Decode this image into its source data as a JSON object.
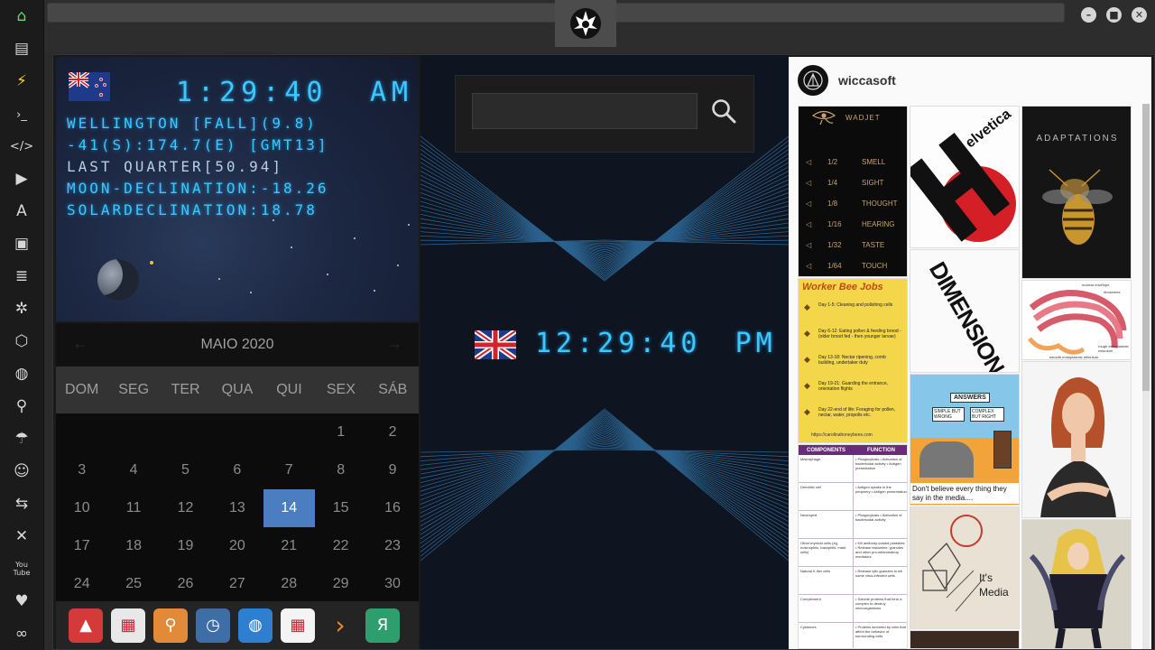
{
  "dock": {
    "items": [
      {
        "name": "home-icon",
        "glyph": "⌂",
        "color": "#6fd46f"
      },
      {
        "name": "document-icon",
        "glyph": "▤"
      },
      {
        "name": "lightning-icon",
        "glyph": "⚡",
        "color": "#f2c94c"
      },
      {
        "name": "terminal-icon",
        "glyph": "›_"
      },
      {
        "name": "code-icon",
        "glyph": "</>"
      },
      {
        "name": "play-icon",
        "glyph": "▶"
      },
      {
        "name": "translate-icon",
        "glyph": "A"
      },
      {
        "name": "image-icon",
        "glyph": "▣"
      },
      {
        "name": "news-icon",
        "glyph": "≣"
      },
      {
        "name": "aperture-icon",
        "glyph": "✲"
      },
      {
        "name": "hexagon-icon",
        "glyph": "⬡"
      },
      {
        "name": "globe-icon",
        "glyph": "◍"
      },
      {
        "name": "search-icon",
        "glyph": "⚲"
      },
      {
        "name": "umbrella-icon",
        "glyph": "☂"
      },
      {
        "name": "contacts-icon",
        "glyph": "☺"
      },
      {
        "name": "link-icon",
        "glyph": "⇆"
      },
      {
        "name": "fullscreen-icon",
        "glyph": "✕"
      },
      {
        "name": "youtube-icon",
        "glyph": "You\nTube"
      },
      {
        "name": "heart-icon",
        "glyph": "♥"
      },
      {
        "name": "cloud-icon",
        "glyph": "∞"
      }
    ]
  },
  "titlebar": {
    "emblem": "rebel-alliance-icon"
  },
  "nz_clock": {
    "time": "1:29:40",
    "ampm": "AM",
    "lines": [
      "WELLINGTON [FALL](9.8)",
      "-41(S):174.7(E) [GMT13]",
      "LAST QUARTER[50.94]",
      "MOON-DECLINATION:-18.26",
      "SOLARDECLINATION:18.78"
    ]
  },
  "calendar": {
    "title": "MAIO 2020",
    "prev": "←",
    "next": "→",
    "weekdays": [
      "DOM",
      "SEG",
      "TER",
      "QUA",
      "QUI",
      "SEX",
      "SÁB"
    ],
    "days": [
      "",
      "",
      "",
      "",
      "",
      "1",
      "2",
      "3",
      "4",
      "5",
      "6",
      "7",
      "8",
      "9",
      "10",
      "11",
      "12",
      "13",
      "14",
      "15",
      "16",
      "17",
      "18",
      "19",
      "20",
      "21",
      "22",
      "23",
      "24",
      "25",
      "26",
      "27",
      "28",
      "29",
      "30"
    ],
    "today": "14",
    "accent": "#4a7ec0"
  },
  "taskbar": {
    "items": [
      {
        "name": "launcher-icon",
        "glyph": "▲",
        "bg": "#d43a3a"
      },
      {
        "name": "news-app-icon",
        "glyph": "▦",
        "bg": "#e8e8e8"
      },
      {
        "name": "search-app-icon",
        "glyph": "⚲",
        "bg": "#e08a3a"
      },
      {
        "name": "clock-app-icon",
        "glyph": "◷",
        "bg": "#3e6ea8"
      },
      {
        "name": "browser-app-icon",
        "glyph": "◍",
        "bg": "#2f7fd0"
      },
      {
        "name": "calendar-app-icon",
        "glyph": "▦",
        "bg": "#f4f4f4"
      },
      {
        "name": "next-app-icon",
        "glyph": "›",
        "bg": "#242424"
      },
      {
        "name": "yandex-app-icon",
        "glyph": "Я",
        "bg": "#2f9e6e"
      }
    ]
  },
  "search": {
    "placeholder": ""
  },
  "uk_clock": {
    "time": "12:29:40",
    "ampm": "PM"
  },
  "pinterest": {
    "username": "wiccasoft",
    "pins": {
      "wadjet": {
        "title": "WADJET",
        "rows": [
          {
            "fraction": "1/2",
            "sense": "SMELL"
          },
          {
            "fraction": "1/4",
            "sense": "SIGHT"
          },
          {
            "fraction": "1/8",
            "sense": "THOUGHT"
          },
          {
            "fraction": "1/16",
            "sense": "HEARING"
          },
          {
            "fraction": "1/32",
            "sense": "TASTE"
          },
          {
            "fraction": "1/64",
            "sense": "TOUCH"
          }
        ]
      },
      "helvetica": {
        "word": "elvetica"
      },
      "adaptations": {
        "title": "ADAPTATIONS"
      },
      "bee": {
        "title": "Worker Bee Jobs",
        "items": [
          "Day 1-5: Cleaning and polishing cells",
          "Day 6-12: Eating pollen & feeding brood - (older brood fed - then younger larvae)",
          "Day 13-18: Nectar ripening, comb building, undertaker duty",
          "Day 19-21: Guarding the entrance, orientation flights",
          "Day 22-end of life: Foraging for pollen, nectar, water, propolis etc."
        ],
        "url": "https://carolinahoneybees.com"
      },
      "dimension": {
        "word": "DIMENSION"
      },
      "answers": {
        "sign": "ANSWERS",
        "left": "SIMPLE BUT WRONG",
        "right": "COMPLEX BUT RIGHT"
      },
      "immune": {
        "headers": [
          "COMPONENTS",
          "FUNCTION"
        ],
        "rows": [
          {
            "component": "Macrophage",
            "function": "• Phagocytosis • Activation of bactericidal activity • Antigen presentation"
          },
          {
            "component": "Dendritic cell",
            "function": "• Antigen uptake in the periphery • Antigen presentation"
          },
          {
            "component": "Neutrophil",
            "function": "• Phagocytosis • Activation of bactericidal activity"
          },
          {
            "component": "Other myeloid cells (eg, eosinophils, basophils, mast cells)",
            "function": "• Kill antibody coated parasites • Release histamine, granules and other pro-inflammatory mediators"
          },
          {
            "component": "Natural K iller cells",
            "function": "• Release lytic granules to kill some virus-infected cells"
          },
          {
            "component": "Complement",
            "function": "• Soluble proteins that form a complex to destroy microorganisms"
          },
          {
            "component": "Cytokines",
            "function": "• Proteins secreted by cells that affect the behavior of surrounding cells"
          }
        ]
      },
      "media": {
        "caption": "Don't believe every thing they say in the media....",
        "label": "It's Media"
      },
      "er": {
        "label_top1": "nuclear envelope",
        "label_top2": "ribosomes",
        "label_right": "rough endoplasmic reticulum",
        "label_bottom": "smooth endoplasmic reticulum"
      }
    }
  }
}
